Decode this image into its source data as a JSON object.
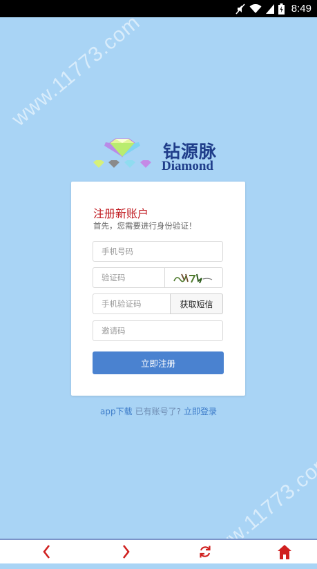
{
  "status_bar": {
    "time": "8:49",
    "icons": [
      "mute-icon",
      "wifi-icon",
      "signal-icon",
      "battery-icon"
    ]
  },
  "watermark": {
    "text": "www.11773.com"
  },
  "logo": {
    "name_cn": "钻源脉",
    "name_en": "Diamond"
  },
  "form": {
    "title": "注册新账户",
    "subtitle": "首先，您需要进行身份验证！",
    "phone_placeholder": "手机号码",
    "captcha_placeholder": "验证码",
    "sms_code_placeholder": "手机验证码",
    "sms_button": "获取短信",
    "invite_placeholder": "邀请码",
    "submit_button": "立即注册"
  },
  "footer": {
    "app_download": "app下载",
    "have_account": "已有账号了?",
    "login_now": "立即登录"
  },
  "bottom_nav": {
    "items": [
      "back-icon",
      "forward-icon",
      "refresh-icon",
      "home-icon"
    ]
  },
  "colors": {
    "background": "#a9d4f5",
    "title_red": "#c0191f",
    "primary_button": "#4a82d0",
    "link": "#3d7cc9",
    "nav_icon": "#d0201f",
    "logo_text": "#1f3d8a"
  }
}
